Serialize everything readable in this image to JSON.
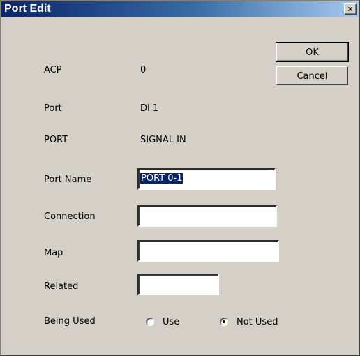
{
  "window": {
    "title": "Port Edit",
    "close_glyph": "×"
  },
  "buttons": {
    "ok": "OK",
    "cancel": "Cancel"
  },
  "info": [
    {
      "label": "ACP",
      "value": "0"
    },
    {
      "label": "Port",
      "value": "DI 1"
    },
    {
      "label": "PORT",
      "value": "SIGNAL IN"
    }
  ],
  "fields": {
    "port_name": {
      "label": "Port Name",
      "value": "PORT 0-1"
    },
    "connection": {
      "label": "Connection",
      "value": ""
    },
    "map": {
      "label": "Map",
      "value": ""
    },
    "related": {
      "label": "Related",
      "value": ""
    }
  },
  "being_used": {
    "label": "Being Used",
    "options": [
      {
        "label": "Use",
        "selected": false
      },
      {
        "label": "Not Used",
        "selected": true
      }
    ]
  }
}
